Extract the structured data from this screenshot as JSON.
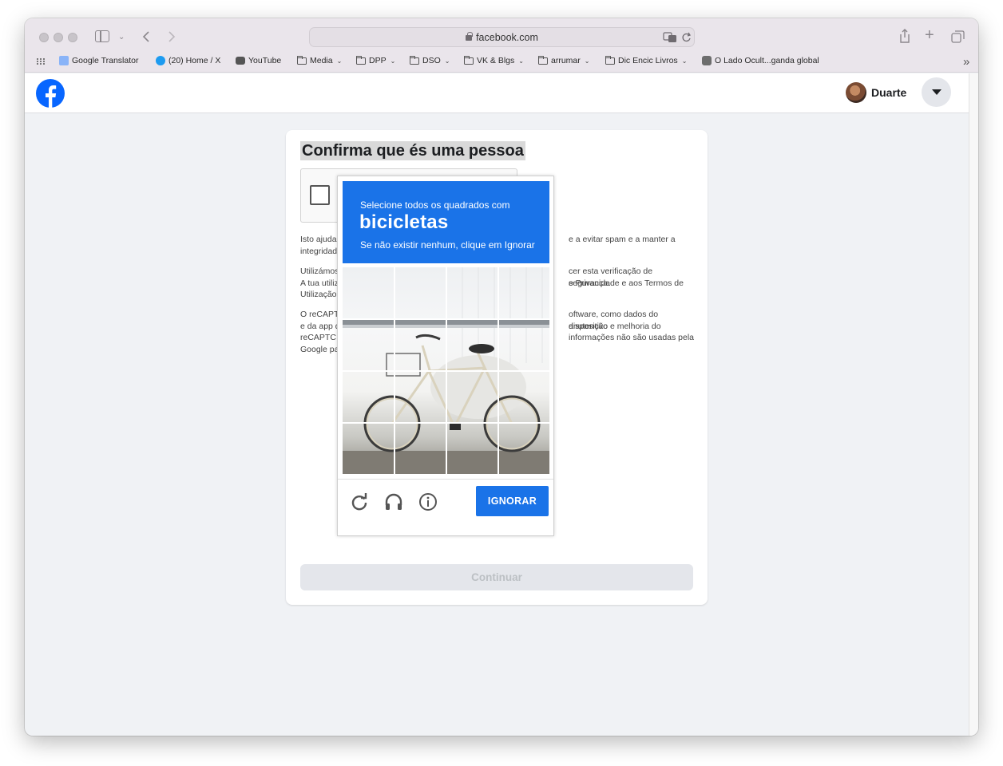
{
  "browser": {
    "url": "facebook.com",
    "bookmarks": [
      {
        "label": "Google Translator",
        "kind": "translate"
      },
      {
        "label": "(20) Home / X",
        "kind": "twitter"
      },
      {
        "label": "YouTube",
        "kind": "youtube"
      },
      {
        "label": "Media",
        "kind": "folder"
      },
      {
        "label": "DPP",
        "kind": "folder"
      },
      {
        "label": "DSO",
        "kind": "folder"
      },
      {
        "label": "VK & Blgs",
        "kind": "folder"
      },
      {
        "label": "arrumar",
        "kind": "folder"
      },
      {
        "label": "Dic Encic Livros",
        "kind": "folder"
      },
      {
        "label": "O Lado Ocult...ganda global",
        "kind": "page"
      }
    ],
    "chevron_glyph": "⌄",
    "overflow_glyph": "»"
  },
  "facebook": {
    "user_name": "Duarte",
    "brand_color": "#0866ff"
  },
  "card": {
    "title": "Confirma que és uma pessoa",
    "para1_left": "Isto ajuda",
    "para1_left2": "integridad",
    "para1_right": "e a evitar spam e a manter a",
    "para2_left": "Utilizámos",
    "para2_left2": "A tua utiliz",
    "para2_left3": "Utilização",
    "para2_right": "cer esta verificação de segurança.",
    "para2_right2": "e Privacidade e aos Termos de",
    "para3_left": "O reCAPT",
    "para3_left2": "e da app d",
    "para3_left3": "reCAPTC",
    "para3_left4": "Google pa",
    "para3_right": "oftware, como dados do dispositivo",
    "para3_right2": "anutenção e melhoria do",
    "para3_right3": "informações não são usadas pela",
    "continue_label": "Continuar"
  },
  "challenge": {
    "line1": "Selecione todos os quadrados com",
    "target": "bicicletas",
    "line3": "Se não existir nenhum, clique em Ignorar",
    "ignore_label": "IGNORAR",
    "accent": "#1a73e8"
  }
}
